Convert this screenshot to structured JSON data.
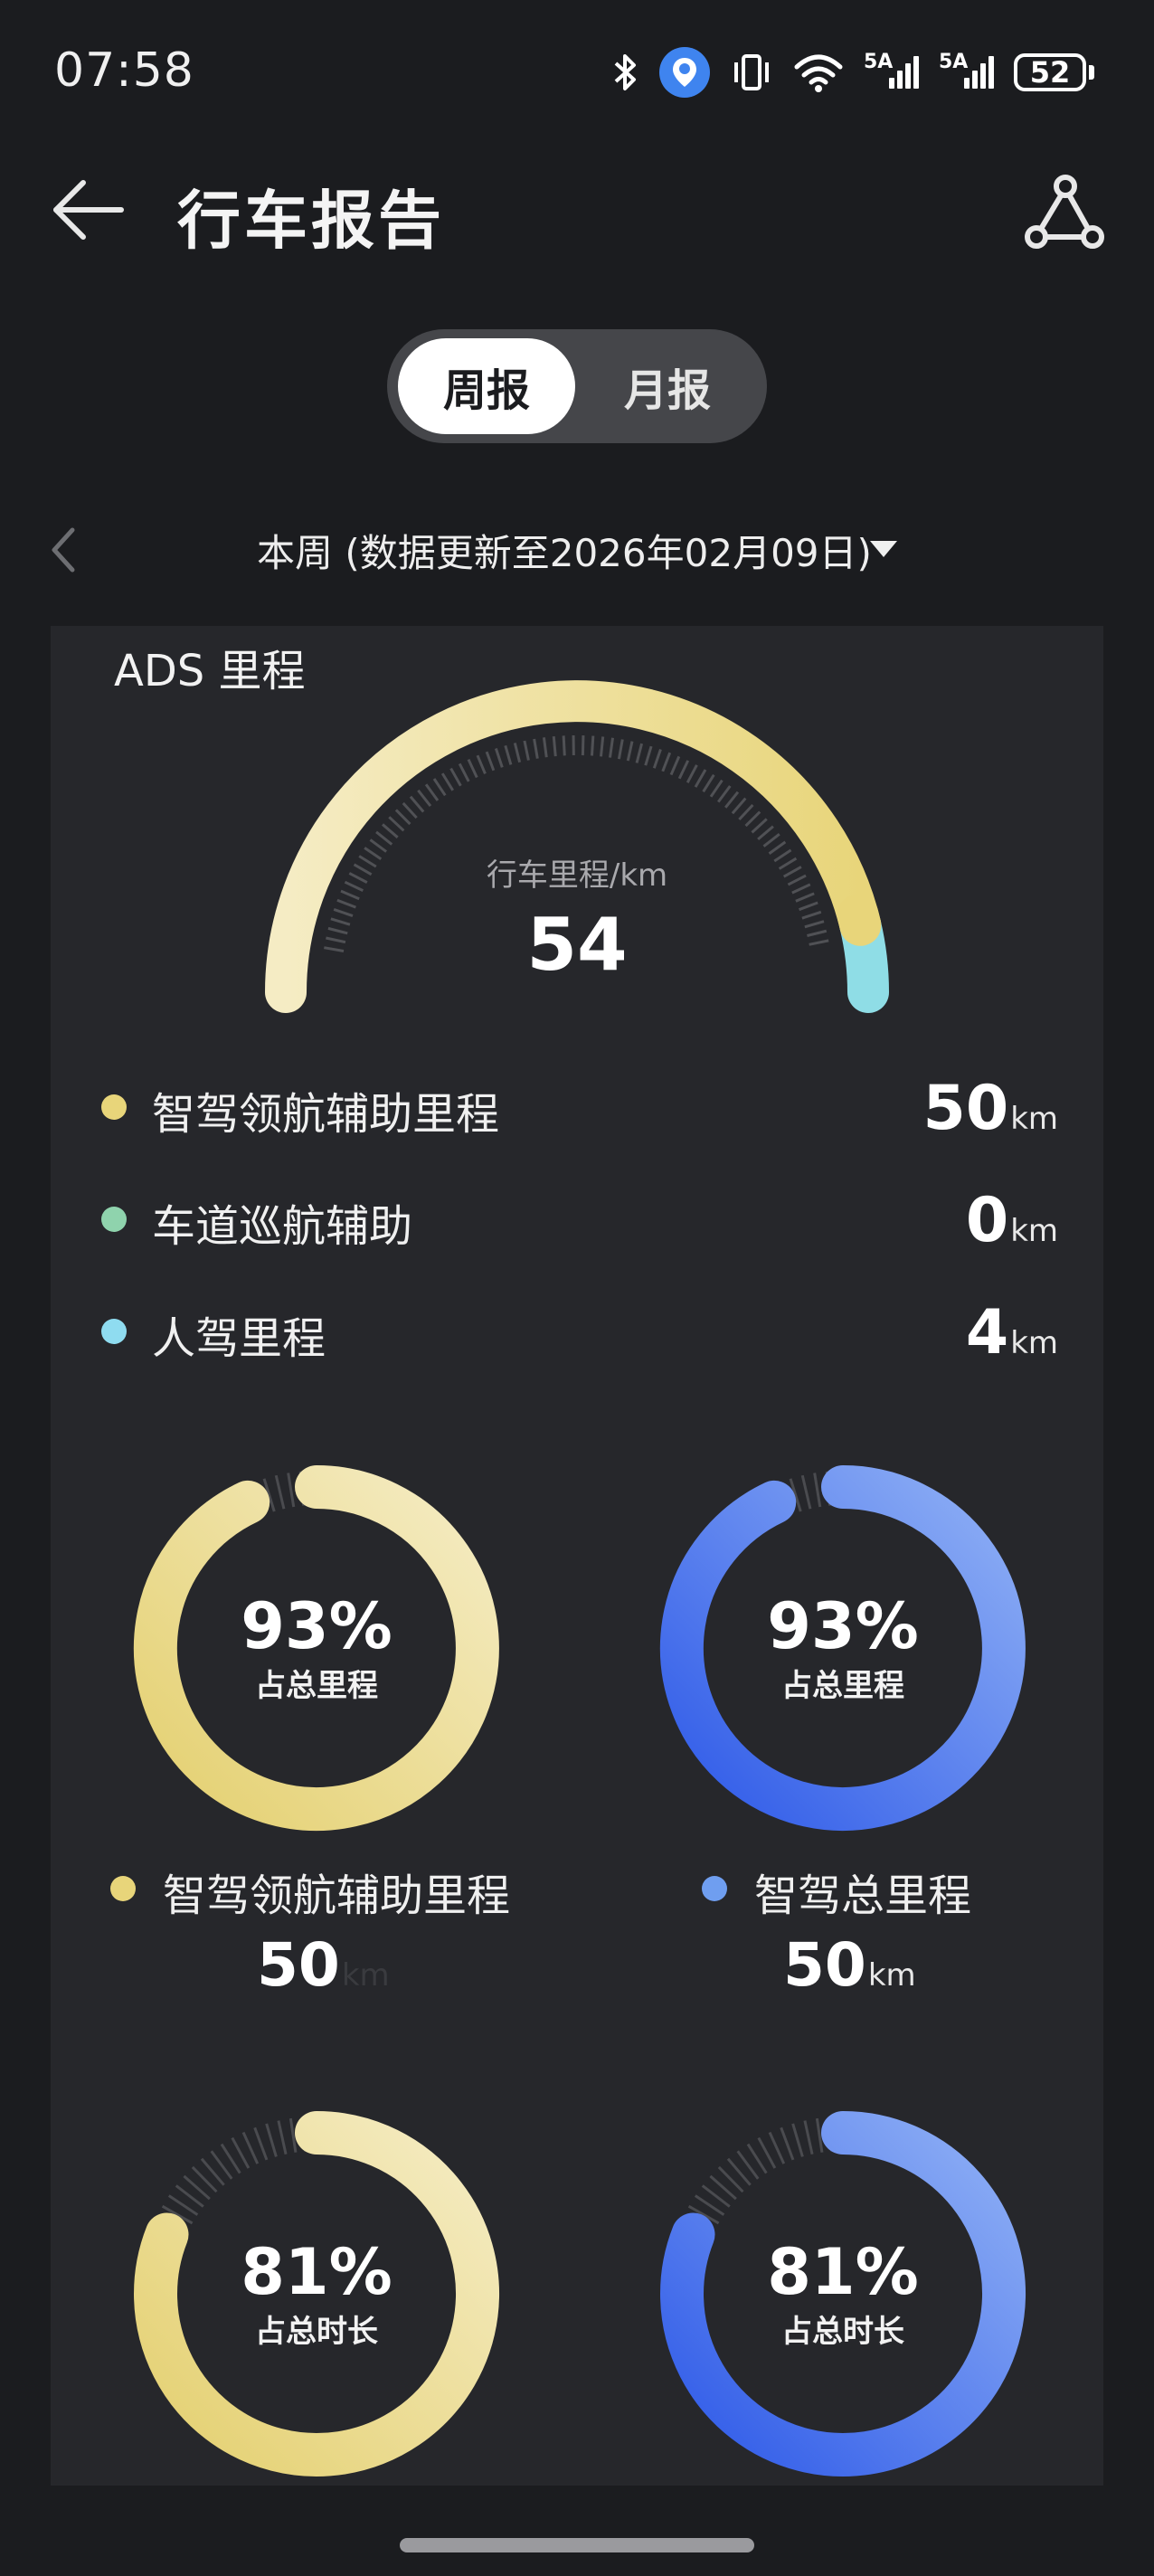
{
  "status_bar": {
    "time": "07:58",
    "battery": "52",
    "signal1_tag": "5A",
    "signal2_tag": "5A",
    "icons": [
      "bluetooth-icon",
      "location-icon",
      "vibrate-icon",
      "wifi-icon",
      "signal-icon",
      "signal-icon",
      "battery-icon"
    ]
  },
  "header": {
    "title": "行车报告",
    "back_icon": "arrow-left-icon",
    "share_icon": "share-icon"
  },
  "tabs": [
    {
      "label": "周报",
      "active": true
    },
    {
      "label": "月报",
      "active": false
    }
  ],
  "period": {
    "label": "本周 (数据更新至2026年02月09日)",
    "prev_icon": "chevron-left-icon",
    "dropdown_icon": "caret-down-icon"
  },
  "ads": {
    "title": "ADS 里程",
    "gauge_label": "行车里程/km",
    "gauge_value": "54",
    "legend": [
      {
        "label": "智驾领航辅助里程",
        "value": "50",
        "unit": "km",
        "color": "#e8d57a"
      },
      {
        "label": "车道巡航辅助",
        "value": "0",
        "unit": "km",
        "color": "#8fd3ad"
      },
      {
        "label": "人驾里程",
        "value": "4",
        "unit": "km",
        "color": "#8fdcf0"
      }
    ],
    "gauge_fractions": {
      "nav_assist": 0.926,
      "lane_cruise": 0.0,
      "manual": 0.074
    }
  },
  "rings_distance": [
    {
      "pct": "93%",
      "sub": "占总里程",
      "fraction": 0.93,
      "legend": "智驾领航辅助里程",
      "value": "50",
      "unit": "km",
      "theme": "gold",
      "dot_color": "#e8d57a"
    },
    {
      "pct": "93%",
      "sub": "占总里程",
      "fraction": 0.93,
      "legend": "智驾总里程",
      "value": "50",
      "unit": "km",
      "theme": "blue",
      "dot_color": "#6f9ef0"
    }
  ],
  "rings_time": [
    {
      "pct": "81%",
      "sub": "占总时长",
      "fraction": 0.81,
      "theme": "gold"
    },
    {
      "pct": "81%",
      "sub": "占总时长",
      "fraction": 0.81,
      "theme": "blue"
    }
  ],
  "colors": {
    "background": "#1b1c1f",
    "card": "#26272b",
    "gold_light": "#f5ecc4",
    "gold_dark": "#e4d070",
    "blue_light": "#8fb0f5",
    "blue_dark": "#2f5ae8",
    "cyan": "#8fdde6",
    "tick": "#505155"
  }
}
